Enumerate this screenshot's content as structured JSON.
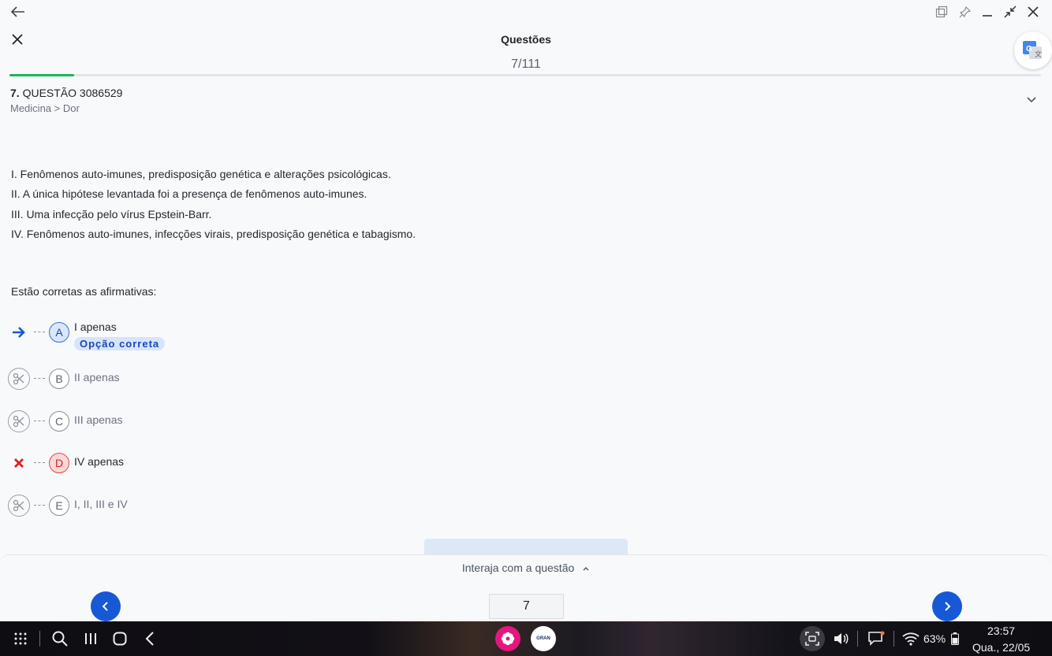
{
  "header": {
    "title": "Questões",
    "counter": "7/111",
    "progress_fraction": 0.063
  },
  "question": {
    "number": "7.",
    "label": "QUESTÃO 3086529",
    "path": "Medicina > Dor",
    "statements": [
      "I. Fenômenos auto-imunes, predisposição genética e alterações psicológicas.",
      "II. A única hipótese levantada foi a presença de fenômenos auto-imunes.",
      "III. Uma infecção pelo vírus Epstein-Barr.",
      "IV. Fenômenos auto-imunes, infecções virais, predisposição genética e tabagismo."
    ],
    "prompt": "Estão corretas as afirmativas:"
  },
  "options": [
    {
      "letter": "A",
      "text": "I apenas",
      "badge": "Opção correta",
      "status_icon": "arrow-right-icon"
    },
    {
      "letter": "B",
      "text": "II apenas",
      "status_icon": "scissors-icon"
    },
    {
      "letter": "C",
      "text": "III apenas",
      "status_icon": "scissors-icon"
    },
    {
      "letter": "D",
      "text": "IV apenas",
      "status_icon": "wrong-x-icon"
    },
    {
      "letter": "E",
      "text": "I, II, III e IV",
      "status_icon": "scissors-icon"
    }
  ],
  "footer": {
    "interact_label": "Interaja com a questão",
    "page_input_value": "7"
  },
  "taskbar": {
    "apps": [
      "flower-app-icon",
      "gran-app-icon"
    ],
    "gran_label": "GRAN",
    "battery": "63%",
    "time": "23:57",
    "date": "Qua., 22/05"
  },
  "colors": {
    "accent": "#1658d6",
    "progress": "#1fb35c",
    "correct_bg": "#d6e4ff",
    "wrong": "#e02020"
  }
}
